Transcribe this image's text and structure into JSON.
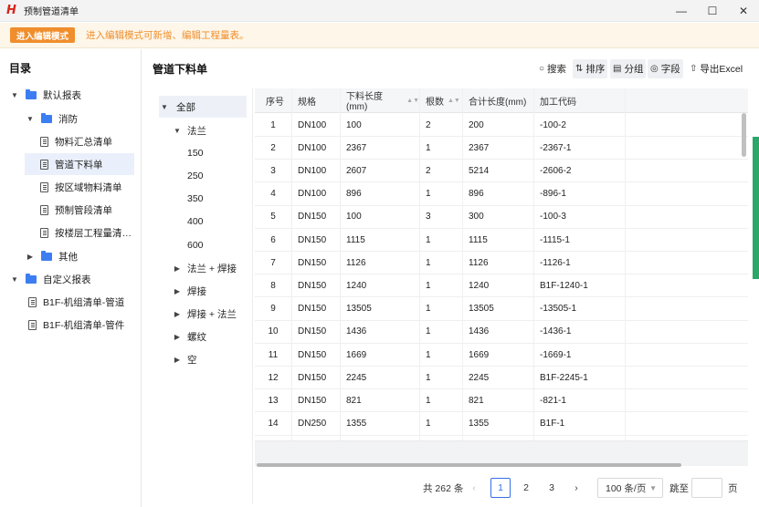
{
  "window": {
    "title": "预制管道清单",
    "minimize": "—",
    "maximize": "☐",
    "close": "✕"
  },
  "notice": {
    "button": "进入编辑模式",
    "text": "进入编辑模式可新增、编辑工程量表。"
  },
  "sidebar": {
    "title": "目录",
    "items": [
      {
        "label": "默认报表"
      },
      {
        "label": "消防"
      },
      {
        "label": "物料汇总清单"
      },
      {
        "label": "管道下料单"
      },
      {
        "label": "按区域物料清单"
      },
      {
        "label": "预制管段清单"
      },
      {
        "label": "按楼层工程量清…"
      },
      {
        "label": "其他"
      },
      {
        "label": "自定义报表"
      },
      {
        "label": "B1F-机组清单-管道"
      },
      {
        "label": "B1F-机组清单-管件"
      }
    ]
  },
  "main": {
    "title": "管道下料单",
    "toolbar": {
      "search": "搜索",
      "sort": "排序",
      "group": "分组",
      "fields": "字段",
      "export": "导出Excel"
    }
  },
  "filter": {
    "items": [
      {
        "label": "全部"
      },
      {
        "label": "法兰"
      },
      {
        "label": "150"
      },
      {
        "label": "250"
      },
      {
        "label": "350"
      },
      {
        "label": "400"
      },
      {
        "label": "600"
      },
      {
        "label": "法兰 + 焊接"
      },
      {
        "label": "焊接"
      },
      {
        "label": "焊接 + 法兰"
      },
      {
        "label": "螺纹"
      },
      {
        "label": "空"
      }
    ]
  },
  "table": {
    "headers": [
      "序号",
      "规格",
      "下料长度(mm)",
      "根数",
      "合计长度(mm)",
      "加工代码"
    ],
    "rows": [
      [
        "1",
        "DN100",
        "100",
        "2",
        "200",
        "-100-2"
      ],
      [
        "2",
        "DN100",
        "2367",
        "1",
        "2367",
        "-2367-1"
      ],
      [
        "3",
        "DN100",
        "2607",
        "2",
        "5214",
        "-2606-2"
      ],
      [
        "4",
        "DN100",
        "896",
        "1",
        "896",
        "-896-1"
      ],
      [
        "5",
        "DN150",
        "100",
        "3",
        "300",
        "-100-3"
      ],
      [
        "6",
        "DN150",
        "1115",
        "1",
        "1115",
        "-1115-1"
      ],
      [
        "7",
        "DN150",
        "1126",
        "1",
        "1126",
        "-1126-1"
      ],
      [
        "8",
        "DN150",
        "1240",
        "1",
        "1240",
        "B1F-1240-1"
      ],
      [
        "9",
        "DN150",
        "13505",
        "1",
        "13505",
        "-13505-1"
      ],
      [
        "10",
        "DN150",
        "1436",
        "1",
        "1436",
        "-1436-1"
      ],
      [
        "11",
        "DN150",
        "1669",
        "1",
        "1669",
        "-1669-1"
      ],
      [
        "12",
        "DN150",
        "2245",
        "1",
        "2245",
        "B1F-2245-1"
      ],
      [
        "13",
        "DN150",
        "821",
        "1",
        "821",
        "-821-1"
      ],
      [
        "14",
        "DN250",
        "1355",
        "1",
        "1355",
        "B1F-1"
      ]
    ]
  },
  "pagination": {
    "total": "共 262 条",
    "prev": "‹",
    "pages": [
      "1",
      "2",
      "3"
    ],
    "next": "›",
    "page_size": "100 条/页",
    "jump_label": "跳至",
    "jump_unit": "页"
  },
  "colors": {
    "accent": "#3470e8",
    "notice_orange": "#f08e2c",
    "folder_blue": "#3c7ef2",
    "logo_red": "#d9241b"
  }
}
